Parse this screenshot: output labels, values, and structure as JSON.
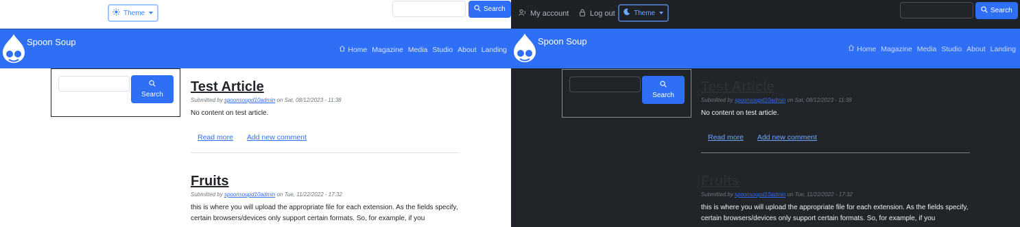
{
  "theme_label": "Theme",
  "user_menu": {
    "my_account": "My account",
    "log_out": "Log out"
  },
  "search": {
    "button_label": "Search",
    "placeholder": ""
  },
  "site": {
    "name": "Spoon Soup"
  },
  "nav": {
    "items": [
      "Home",
      "Magazine",
      "Media",
      "Studio",
      "About",
      "Landing"
    ]
  },
  "sidebar": {
    "search_button": "Search"
  },
  "articles": [
    {
      "title": "Test Article",
      "submitted_prefix": "Submitted by",
      "author": "spoonsoupd10admin",
      "date_text": "on Sat, 08/12/2023 - 11:38",
      "body": "No content on test article.",
      "links": [
        "Read more",
        "Add new comment"
      ]
    },
    {
      "title": "Fruits",
      "submitted_prefix": "Submitted by",
      "author": "spoonsoupd10admin",
      "date_text": "on Tue, 11/22/2022 - 17:32",
      "body": "this is where you will upload the appropriate file for each extension. As the fields specify, certain browsers/devices only support certain formats. So, for example, if you"
    }
  ],
  "colors": {
    "brand_blue": "#2f6ff5",
    "dark_bg": "#212529",
    "light_bg": "#ffffff"
  },
  "icons": [
    "sun-icon",
    "moon-icon",
    "search-icon",
    "person-icon",
    "lock-icon",
    "home-icon",
    "drupal-drop-logo"
  ]
}
